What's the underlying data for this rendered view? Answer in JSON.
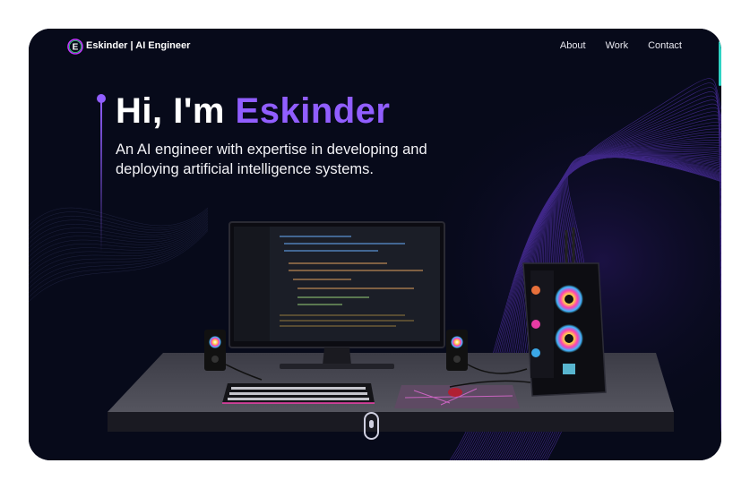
{
  "nav": {
    "logo_letter": "E",
    "brand": "Eskinder | AI Engineer",
    "links": [
      "About",
      "Work",
      "Contact"
    ]
  },
  "hero": {
    "greeting": "Hi, I'm ",
    "name": "Eskinder",
    "subtitle": "An AI engineer with expertise in developing and deploying artificial intelligence systems."
  },
  "colors": {
    "background": "#070a1a",
    "accent": "#915eff",
    "text": "#ffffff",
    "edge_accent": "#2fd3c4"
  },
  "icons": {
    "logo": "e-logo-icon",
    "scroll": "scroll-down-icon"
  }
}
